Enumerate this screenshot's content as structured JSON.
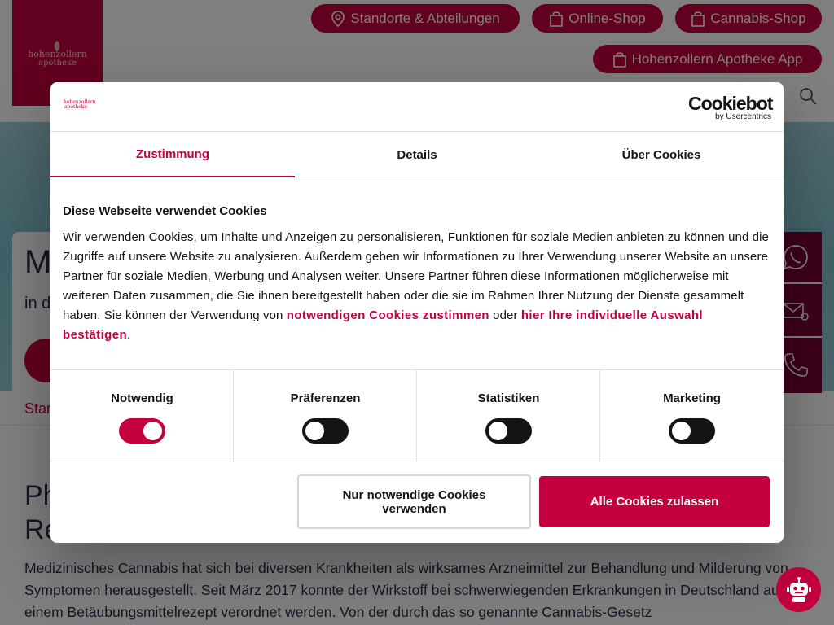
{
  "brand": {
    "logo_line1": "hohenzollern",
    "logo_line2": "apotheke",
    "accent": "#c4003f",
    "dark_accent": "#7a0037"
  },
  "header": {
    "nav": [
      {
        "label": "Standorte & Abteilungen",
        "icon": "location-pin-icon"
      },
      {
        "label": "Online-Shop",
        "icon": "shopping-bag-icon"
      },
      {
        "label": "Cannabis-Shop",
        "icon": "shopping-bag-icon"
      },
      {
        "label": "Hohenzollern Apotheke App",
        "icon": "shopping-bag-icon"
      }
    ],
    "search_icon": "search-icon"
  },
  "hero": {
    "title_visible": "M",
    "subtitle_visible": "in d"
  },
  "page": {
    "breadcrumb_visible": "Star",
    "heading_line1": "Ph",
    "heading_line2": "Re",
    "paragraph": "Medizinisches Cannabis hat sich bei diversen Krankheiten als wirksames Arzneimittel zur Behandlung und Milderung von Symptomen herausgestellt. Seit März 2017 konnte der Wirkstoff bei schwerwiegenden Erkrankungen in Deutschland auf einem Betäubungsmittelrezept verordnet werden. Von der durch das so genannte Cannabis-Gesetz"
  },
  "contact_sidebar": {
    "icons": [
      "whatsapp-icon",
      "mail-icon",
      "phone-icon"
    ]
  },
  "chatbot": {
    "icon": "robot-icon"
  },
  "cookie_dialog": {
    "cookiebot_brand": "Cookiebot",
    "cookiebot_sub": "by Usercentrics",
    "tabs": [
      "Zustimmung",
      "Details",
      "Über Cookies"
    ],
    "active_tab": "Zustimmung",
    "heading": "Diese Webseite verwendet Cookies",
    "body_text": "Wir verwenden Cookies, um Inhalte und Anzeigen zu personalisieren, Funktionen für soziale Medien anbieten zu können und die Zugriffe auf unsere Website zu analysieren. Außerdem geben wir Informationen zu Ihrer Verwendung unserer Website an unsere Partner für soziale Medien, Werbung und Analysen weiter. Unsere Partner führen diese Informationen möglicherweise mit weiteren Daten zusammen, die Sie ihnen bereitgestellt haben oder die sie im Rahmen Ihrer Nutzung der Dienste gesammelt haben. Sie können der Verwendung von ",
    "link1": "notwendigen Cookies zustimmen",
    "middle_text": " oder ",
    "link2": "hier Ihre individuelle Auswahl bestätigen",
    "end_text": ".",
    "categories": [
      {
        "label": "Notwendig",
        "on": true
      },
      {
        "label": "Präferenzen",
        "on": false
      },
      {
        "label": "Statistiken",
        "on": false
      },
      {
        "label": "Marketing",
        "on": false
      }
    ],
    "btn_necessary": "Nur notwendige Cookies verwenden",
    "btn_all": "Alle Cookies zulassen"
  }
}
